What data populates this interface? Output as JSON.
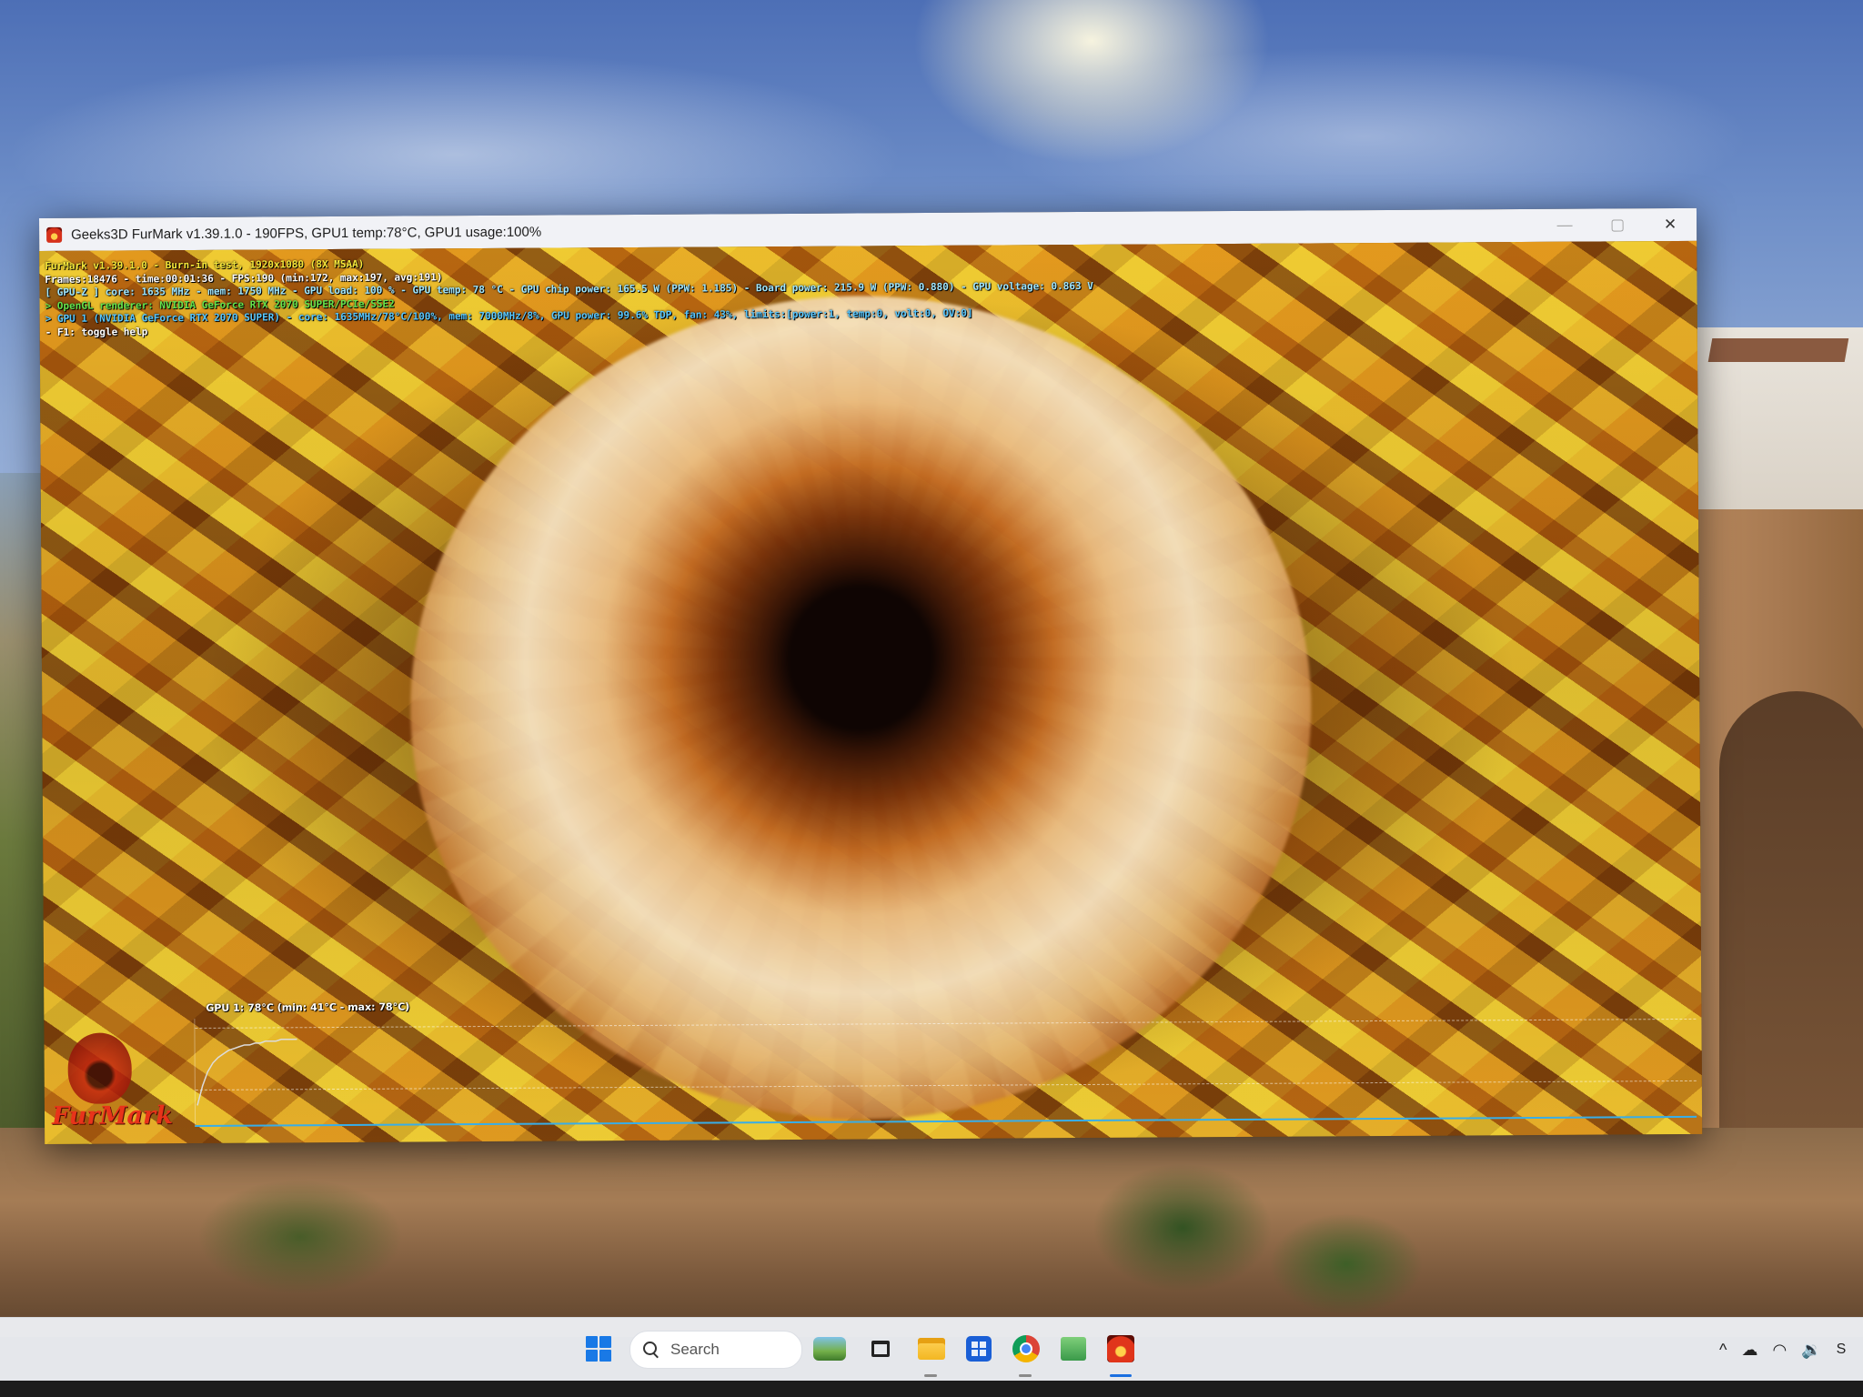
{
  "window": {
    "title": "Geeks3D FurMark v1.39.1.0 - 190FPS, GPU1 temp:78°C, GPU1 usage:100%",
    "minimize_label": "—",
    "maximize_label": "▢",
    "close_label": "✕"
  },
  "osd": {
    "lines": [
      "FurMark v1.39.1.0 - Burn-in test, 1920x1080 (8X MSAA)",
      "Frames:18476 - time:00:01:36 - FPS:190 (min:172, max:197, avg:191)",
      "[ GPU-Z ] core: 1635 MHz - mem: 1750 MHz - GPU load: 100 % - GPU temp: 78 °C - GPU chip power: 165.5 W (PPW: 1.185) - Board power: 215.9 W (PPW: 0.880) - GPU voltage: 0.863 V",
      "> OpenGL renderer: NVIDIA GeForce RTX 2070 SUPER/PCIe/SSE2",
      "> GPU 1 (NVIDIA GeForce RTX 2070 SUPER) - core: 1635MHz/78°C/100%, mem: 7000MHz/8%, GPU power: 99.6% TDP, fan: 43%, limits:[power:1, temp:0, volt:0, OV:0]",
      "- F1: toggle help"
    ]
  },
  "temp_graph": {
    "label": "GPU 1: 78°C (min: 41°C - max: 78°C)",
    "samples": [
      41,
      52,
      60,
      65,
      68,
      70,
      72,
      73,
      74,
      75,
      75,
      76,
      76,
      77,
      77,
      77,
      78,
      78,
      78,
      78
    ]
  },
  "logo": {
    "text": "FurMark"
  },
  "taskbar": {
    "search_placeholder": "Search",
    "tray_chevron": "^",
    "tray_letter": "S"
  },
  "colors": {
    "osd_yellow": "#f6e83a",
    "osd_cyan": "#9fe6ff",
    "osd_green": "#64e34c",
    "graph_line": "#38aee8",
    "accent": "#1a6fe0"
  }
}
